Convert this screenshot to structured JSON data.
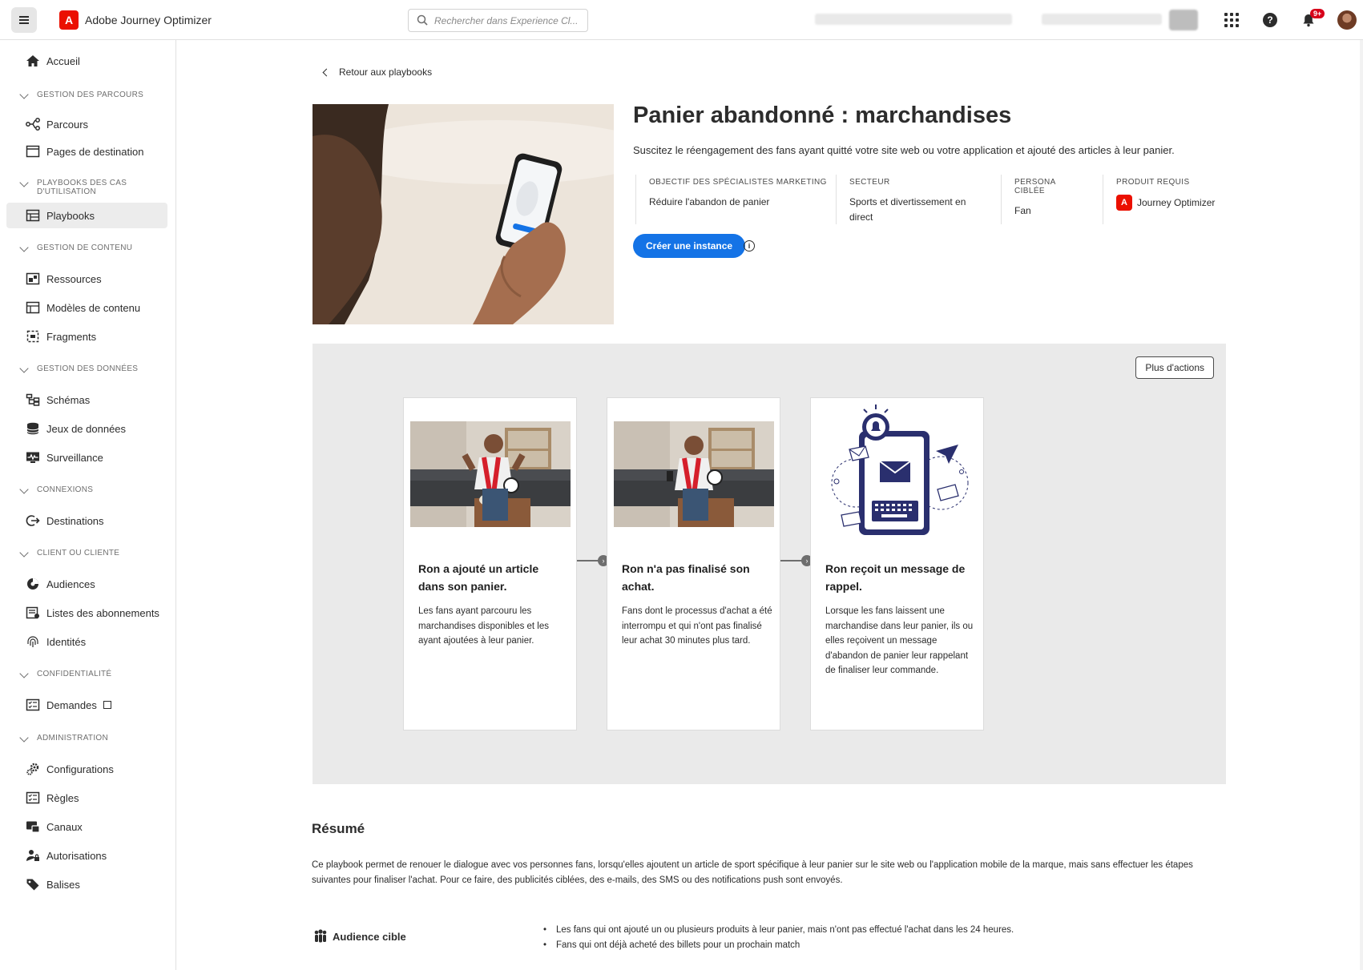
{
  "app": {
    "name": "Adobe Journey Optimizer"
  },
  "search": {
    "placeholder": "Rechercher dans Experience Cl..."
  },
  "header": {
    "notifications_badge": "9+"
  },
  "sidebar": {
    "home": "Accueil",
    "sections": {
      "parcours": "GESTION DES PARCOURS",
      "playbooks": "PLAYBOOKS DES CAS D'UTILISATION",
      "contenu": "GESTION DE CONTENU",
      "donnees": "GESTION DES DONNÉES",
      "connexions": "CONNEXIONS",
      "client": "CLIENT OU CLIENTE",
      "confidentialite": "CONFIDENTIALITÉ",
      "administration": "ADMINISTRATION"
    },
    "items": {
      "parcours": "Parcours",
      "pages": "Pages de destination",
      "playbooks": "Playbooks",
      "ressources": "Ressources",
      "modeles": "Modèles de contenu",
      "fragments": "Fragments",
      "schemas": "Schémas",
      "jeux": "Jeux de données",
      "surveillance": "Surveillance",
      "destinations": "Destinations",
      "audiences": "Audiences",
      "listes": "Listes des abonnements",
      "identites": "Identités",
      "demandes": "Demandes",
      "configurations": "Configurations",
      "regles": "Règles",
      "canaux": "Canaux",
      "autorisations": "Autorisations",
      "balises": "Balises"
    }
  },
  "page": {
    "back_label": "Retour aux playbooks",
    "title": "Panier abandonné : marchandises",
    "description": "Suscitez le réengagement des fans ayant quitté votre site web ou votre application et ajouté des articles à leur panier.",
    "meta": {
      "objectif_label": "OBJECTIF DES SPÉCIALISTES MARKETING",
      "objectif_value": "Réduire l'abandon de panier",
      "secteur_label": "SECTEUR",
      "secteur_value": "Sports et divertissement en direct",
      "persona_label": "PERSONA CIBLÉE",
      "persona_value": "Fan",
      "produit_label": "PRODUIT REQUIS",
      "produit_value": "Journey Optimizer"
    },
    "create_button": "Créer une instance",
    "more_actions": "Plus d'actions",
    "cards": [
      {
        "title": "Ron a ajouté un article dans son panier.",
        "text": "Les fans ayant parcouru les marchandises disponibles et les ayant ajoutées à leur panier."
      },
      {
        "title": "Ron n'a pas finalisé son achat.",
        "text": "Fans dont le processus d'achat a été interrompu et qui n'ont pas finalisé leur achat 30 minutes plus tard."
      },
      {
        "title": "Ron reçoit un message de rappel.",
        "text": "Lorsque les fans laissent une marchandise dans leur panier, ils ou elles reçoivent un message d'abandon de panier leur rappelant de finaliser leur commande."
      }
    ],
    "summary_title": "Résumé",
    "summary_text": "Ce playbook permet de renouer le dialogue avec vos personnes fans, lorsqu'elles ajoutent un article de sport spécifique à leur panier sur le site web ou l'application mobile de la marque, mais sans effectuer les étapes suivantes pour finaliser l'achat. Pour ce faire, des publicités ciblées, des e-mails, des SMS ou des notifications push sont envoyés.",
    "audience_title": "Audience cible",
    "audience_items": [
      "Les fans qui ont ajouté un ou plusieurs produits à leur panier, mais n'ont pas effectué l'achat dans les 24 heures.",
      "Fans qui ont déjà acheté des billets pour un prochain match"
    ]
  },
  "colors": {
    "accent": "#1473e6",
    "adobe_red": "#eb1000",
    "journey_bg": "#eaeaea"
  }
}
